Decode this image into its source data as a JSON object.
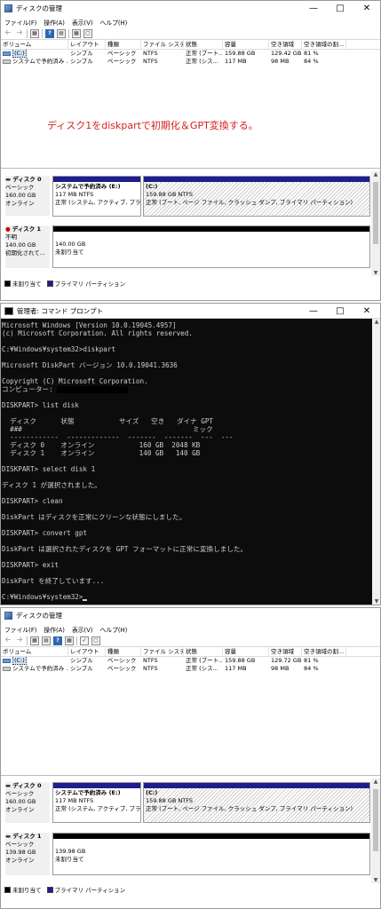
{
  "window1": {
    "title": "ディスクの管理",
    "menu": [
      "ファイル(F)",
      "操作(A)",
      "表示(V)",
      "ヘルプ(H)"
    ],
    "columns": [
      "ボリューム",
      "レイアウト",
      "種類",
      "ファイル システム",
      "状態",
      "容量",
      "空き領域",
      "空き領域の割..."
    ],
    "rows": [
      [
        "(C:)",
        "シンプル",
        "ベーシック",
        "NTFS",
        "正常 (ブート...",
        "159.88 GB",
        "129.42 GB",
        "81 %"
      ],
      [
        "システムで予約済み ...",
        "シンプル",
        "ベーシック",
        "NTFS",
        "正常 (シス...",
        "117 MB",
        "98 MB",
        "84 %"
      ]
    ],
    "note": "ディスク1をdiskpartで初期化＆GPT変換する。",
    "disk0": {
      "name": "ディスク 0",
      "type": "ベーシック",
      "size": "160.00 GB",
      "status": "オンライン"
    },
    "disk0_p1": {
      "name": "システムで予約済み (E:)",
      "size": "117 MB NTFS",
      "status": "正常 (システム, アクティブ, プライマリ..."
    },
    "disk0_p2": {
      "name": "(C:)",
      "size": "159.88 GB NTFS",
      "status": "正常 (ブート, ページ ファイル, クラッシュ ダンプ, プライマリ パーティション)"
    },
    "disk1": {
      "name": "ディスク 1",
      "type": "不明",
      "size": "140.00 GB",
      "status": "初期化されて..."
    },
    "disk1_p1": {
      "size": "140.00 GB",
      "status": "未割り当て"
    },
    "legend": [
      "未割り当て",
      "プライマリ パーティション"
    ]
  },
  "cmd": {
    "title": "管理者: コマンド プロンプト",
    "lines": [
      "Microsoft Windows [Version 10.0.19045.4957]",
      "(c) Microsoft Corporation. All rights reserved.",
      "",
      "C:¥Windows¥system32>diskpart",
      "",
      "Microsoft DiskPart バージョン 10.0.19041.3636",
      "",
      "Copyright (C) Microsoft Corporation.",
      "コンピューター: ",
      "",
      "DISKPART> list disk",
      "",
      "  ディスク      状態           サイズ   空き   ダイナ GPT",
      "  ###                                          ミック",
      "  ------------  -------------  -------  -------  ---  ---",
      "  ディスク 0    オンライン           160 GB  2048 KB",
      "  ディスク 1    オンライン           140 GB   140 GB",
      "",
      "DISKPART> select disk 1",
      "",
      "ディスク 1 が選択されました。",
      "",
      "DISKPART> clean",
      "",
      "DiskPart はディスクを正常にクリーンな状態にしました。",
      "",
      "DISKPART> convert gpt",
      "",
      "DiskPart は選択されたディスクを GPT フォーマットに正常に変換しました。",
      "",
      "DISKPART> exit",
      "",
      "DiskPart を終了しています...",
      "",
      "C:¥Windows¥system32>"
    ]
  },
  "window2": {
    "title": "ディスクの管理",
    "menu": [
      "ファイル(F)",
      "操作(A)",
      "表示(V)",
      "ヘルプ(H)"
    ],
    "columns": [
      "ボリューム",
      "レイアウト",
      "種類",
      "ファイル システム",
      "状態",
      "容量",
      "空き領域",
      "空き領域の割..."
    ],
    "rows": [
      [
        "(C:)",
        "シンプル",
        "ベーシック",
        "NTFS",
        "正常 (ブート...",
        "159.88 GB",
        "129.72 GB",
        "81 %"
      ],
      [
        "システムで予約済み ...",
        "シンプル",
        "ベーシック",
        "NTFS",
        "正常 (シス...",
        "117 MB",
        "98 MB",
        "84 %"
      ]
    ],
    "disk0": {
      "name": "ディスク 0",
      "type": "ベーシック",
      "size": "160.00 GB",
      "status": "オンライン"
    },
    "disk0_p1": {
      "name": "システムで予約済み (E:)",
      "size": "117 MB NTFS",
      "status": "正常 (システム, アクティブ, プライマリ..."
    },
    "disk0_p2": {
      "name": "(C:)",
      "size": "159.88 GB NTFS",
      "status": "正常 (ブート, ページ ファイル, クラッシュ ダンプ, プライマリ パーティション)"
    },
    "disk1": {
      "name": "ディスク 1",
      "type": "ベーシック",
      "size": "139.98 GB",
      "status": "オンライン"
    },
    "disk1_p1": {
      "size": "139.98 GB",
      "status": "未割り当て"
    },
    "legend": [
      "未割り当て",
      "プライマリ パーティション"
    ]
  },
  "colors": {
    "primary_bar": "#1e1e8c",
    "unallocated_bar": "#000000",
    "note_red": "#d61f1f",
    "console_bg": "#0c0c0c"
  }
}
